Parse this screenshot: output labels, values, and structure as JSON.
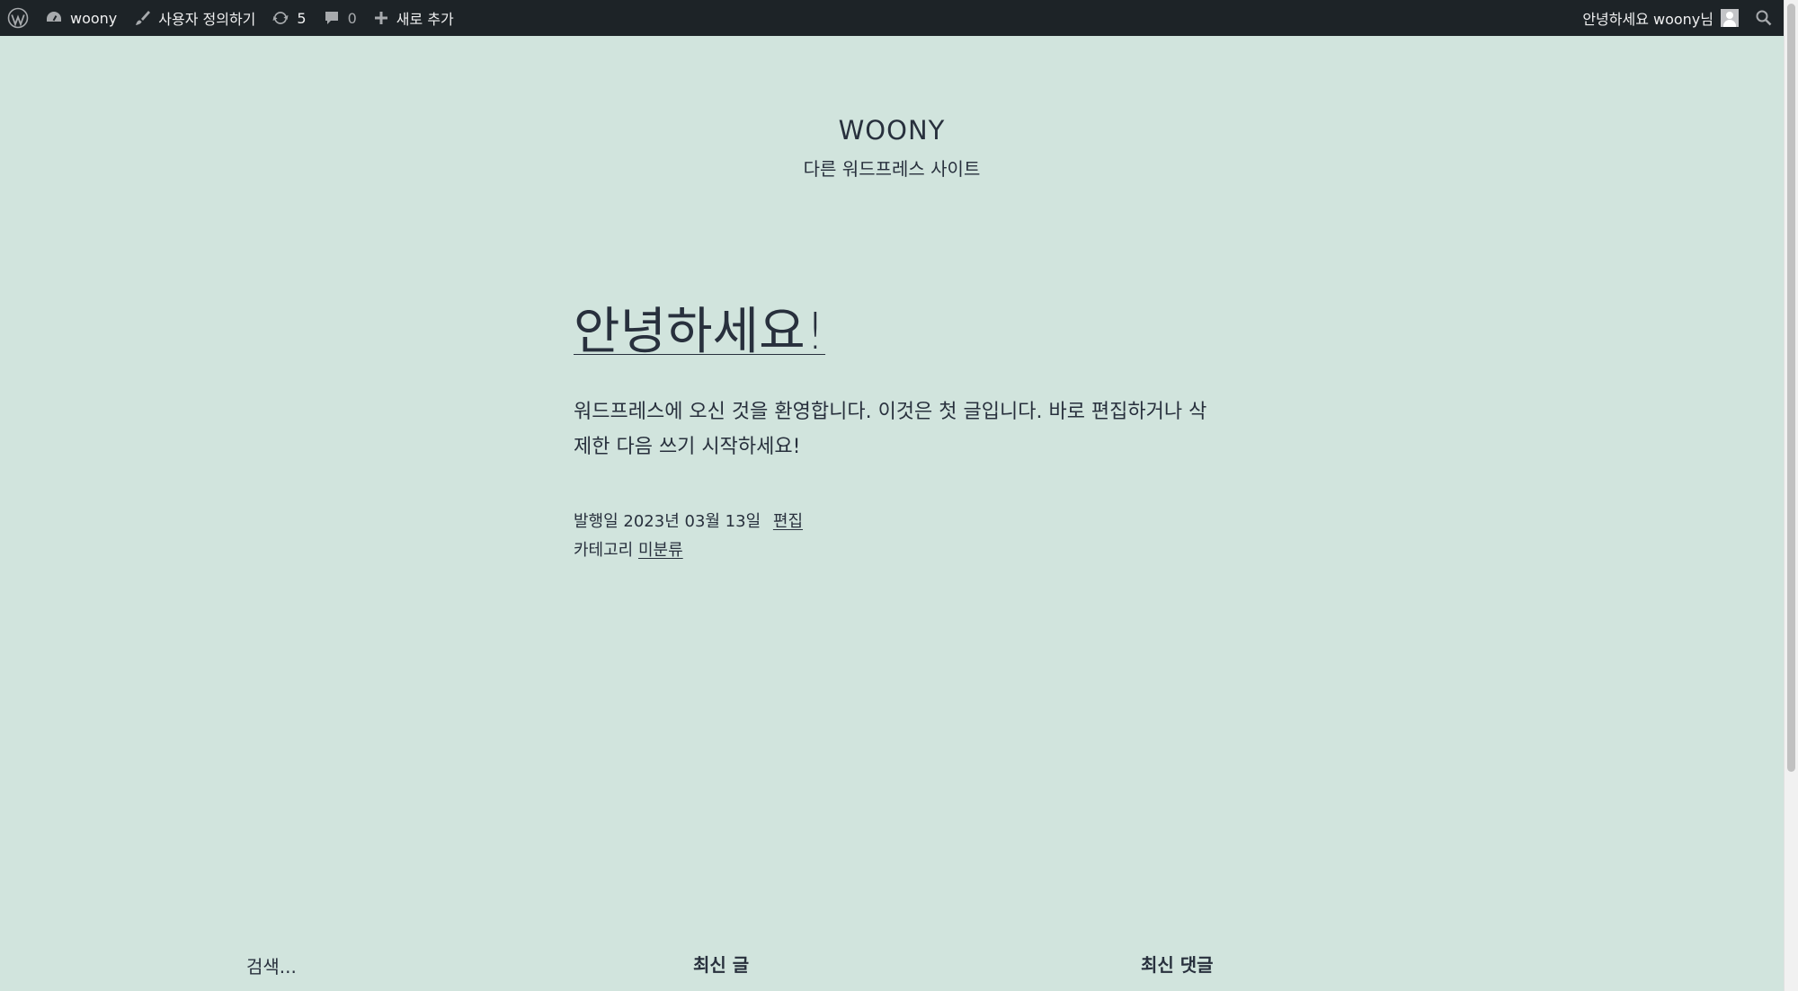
{
  "admin_bar": {
    "site_name": "woony",
    "customize": "사용자 정의하기",
    "updates_count": "5",
    "comments_count": "0",
    "new_content": "새로 추가",
    "greeting": "안녕하세요 woony님"
  },
  "site": {
    "title": "WOONY",
    "description": "다른 워드프레스 사이트"
  },
  "post": {
    "title": "안녕하세요!",
    "content": "워드프레스에 오신 것을 환영합니다. 이것은 첫 글입니다. 바로 편집하거나 삭제한 다음 쓰기 시작하세요!",
    "published": "발행일 2023년 03월 13일",
    "edit_label": "편집",
    "category_prefix": "카테고리",
    "category": "미분류"
  },
  "footer": {
    "search_placeholder": "검색...",
    "recent_posts_title": "최신 글",
    "recent_comments_title": "최신 댓글"
  },
  "colors": {
    "background": "#d1e4dd",
    "admin_bar": "#1d2327",
    "text": "#28303d"
  }
}
